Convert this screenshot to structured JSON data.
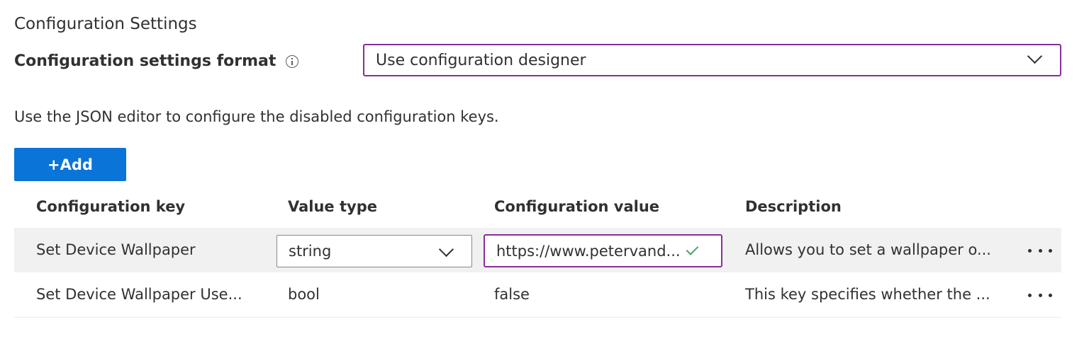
{
  "section": {
    "title": "Configuration Settings"
  },
  "format": {
    "label": "Configuration settings format",
    "info_icon": "info-icon",
    "selected": "Use configuration designer"
  },
  "hint": "Use the JSON editor to configure the disabled configuration keys.",
  "add_button": {
    "label": "+Add",
    "color": "#0a74d9"
  },
  "table": {
    "columns": [
      "Configuration key",
      "Value type",
      "Configuration value",
      "Description"
    ],
    "rows": [
      {
        "key": "Set Device Wallpaper",
        "value_type": "string",
        "value": "https://www.petervand...",
        "description": "Allows you to set a wallpaper o...",
        "more_icon": "more-icon"
      },
      {
        "key": "Set Device Wallpaper Use...",
        "value_type": "bool",
        "value": "false",
        "description": "This key specifies whether the ...",
        "more_icon": "more-icon"
      }
    ]
  },
  "colors": {
    "accent_border": "#8a2c9c",
    "check": "#4aa564",
    "selected_row_bg": "#f2f1f1"
  }
}
